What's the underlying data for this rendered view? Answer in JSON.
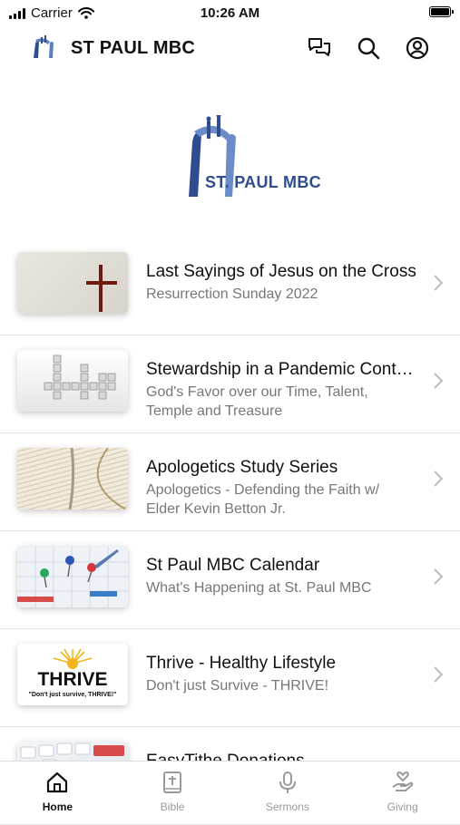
{
  "status_bar": {
    "carrier": "Carrier",
    "time": "10:26 AM"
  },
  "header": {
    "title": "ST PAUL MBC"
  },
  "hero": {
    "brand_text": "ST. PAUL MBC"
  },
  "colors": {
    "brand_blue": "#2f4d8e",
    "accent_gold": "#f1b51c"
  },
  "items": [
    {
      "title": "Last Sayings of Jesus on the Cross",
      "subtitle": "Resurrection Sunday 2022",
      "thumbnail": "cross-image"
    },
    {
      "title": "Stewardship in a Pandemic Context",
      "subtitle": "God's Favor over our Time, Talent, Temple and Treasure",
      "thumbnail": "crossword-tiles-image"
    },
    {
      "title": "Apologetics Study Series",
      "subtitle": "Apologetics -  Defending the Faith w/ Elder Kevin Betton Jr.",
      "thumbnail": "open-bible-image"
    },
    {
      "title": "St Paul MBC Calendar",
      "subtitle": "What's Happening at St. Paul MBC",
      "thumbnail": "calendar-pins-image"
    },
    {
      "title": "Thrive - Healthy Lifestyle",
      "subtitle": "Don't just Survive - THRIVE!",
      "thumbnail": "thrive-logo-image",
      "thumb_text": "THRIVE",
      "thumb_tagline": "\"Don't just survive, THRIVE!\""
    },
    {
      "title": "EasyTithe Donations",
      "subtitle": "",
      "thumbnail": "keyboard-image"
    }
  ],
  "tabs": [
    {
      "label": "Home",
      "icon": "home-icon",
      "active": true
    },
    {
      "label": "Bible",
      "icon": "bible-icon",
      "active": false
    },
    {
      "label": "Sermons",
      "icon": "microphone-icon",
      "active": false
    },
    {
      "label": "Giving",
      "icon": "giving-hand-icon",
      "active": false
    }
  ]
}
